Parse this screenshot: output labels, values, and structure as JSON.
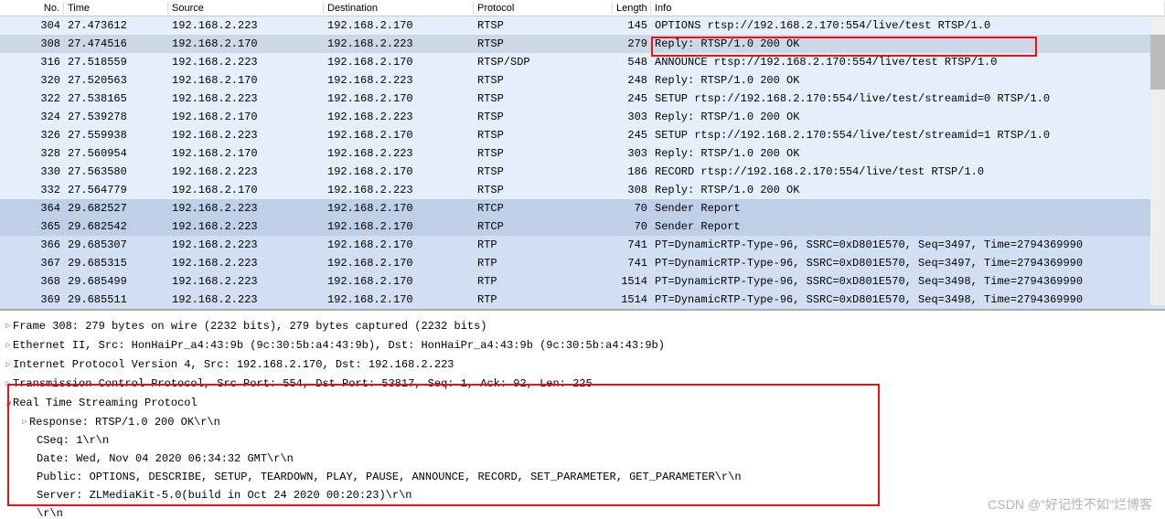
{
  "columns": {
    "no": "No.",
    "time": "Time",
    "src": "Source",
    "dst": "Destination",
    "proto": "Protocol",
    "len": "Length",
    "info": "Info"
  },
  "packets": [
    {
      "no": "304",
      "time": "27.473612",
      "src": "192.168.2.223",
      "dst": "192.168.2.170",
      "proto": "RTSP",
      "len": "145",
      "info": "OPTIONS rtsp://192.168.2.170:554/live/test RTSP/1.0",
      "cls": "alt0"
    },
    {
      "no": "308",
      "time": "27.474516",
      "src": "192.168.2.170",
      "dst": "192.168.2.223",
      "proto": "RTSP",
      "len": "279",
      "info": "Reply: RTSP/1.0 200 OK",
      "cls": "selected"
    },
    {
      "no": "316",
      "time": "27.518559",
      "src": "192.168.2.223",
      "dst": "192.168.2.170",
      "proto": "RTSP/SDP",
      "len": "548",
      "info": "ANNOUNCE rtsp://192.168.2.170:554/live/test RTSP/1.0",
      "cls": "alt0"
    },
    {
      "no": "320",
      "time": "27.520563",
      "src": "192.168.2.170",
      "dst": "192.168.2.223",
      "proto": "RTSP",
      "len": "248",
      "info": "Reply: RTSP/1.0 200 OK",
      "cls": "alt1"
    },
    {
      "no": "322",
      "time": "27.538165",
      "src": "192.168.2.223",
      "dst": "192.168.2.170",
      "proto": "RTSP",
      "len": "245",
      "info": "SETUP rtsp://192.168.2.170:554/live/test/streamid=0 RTSP/1.0",
      "cls": "alt0"
    },
    {
      "no": "324",
      "time": "27.539278",
      "src": "192.168.2.170",
      "dst": "192.168.2.223",
      "proto": "RTSP",
      "len": "303",
      "info": "Reply: RTSP/1.0 200 OK",
      "cls": "alt1"
    },
    {
      "no": "326",
      "time": "27.559938",
      "src": "192.168.2.223",
      "dst": "192.168.2.170",
      "proto": "RTSP",
      "len": "245",
      "info": "SETUP rtsp://192.168.2.170:554/live/test/streamid=1 RTSP/1.0",
      "cls": "alt0"
    },
    {
      "no": "328",
      "time": "27.560954",
      "src": "192.168.2.170",
      "dst": "192.168.2.223",
      "proto": "RTSP",
      "len": "303",
      "info": "Reply: RTSP/1.0 200 OK",
      "cls": "alt1"
    },
    {
      "no": "330",
      "time": "27.563580",
      "src": "192.168.2.223",
      "dst": "192.168.2.170",
      "proto": "RTSP",
      "len": "186",
      "info": "RECORD rtsp://192.168.2.170:554/live/test RTSP/1.0",
      "cls": "alt0"
    },
    {
      "no": "332",
      "time": "27.564779",
      "src": "192.168.2.170",
      "dst": "192.168.2.223",
      "proto": "RTSP",
      "len": "308",
      "info": "Reply: RTSP/1.0 200 OK",
      "cls": "alt1"
    },
    {
      "no": "364",
      "time": "29.682527",
      "src": "192.168.2.223",
      "dst": "192.168.2.170",
      "proto": "RTCP",
      "len": "70",
      "info": "Sender Report",
      "cls": "rtcp"
    },
    {
      "no": "365",
      "time": "29.682542",
      "src": "192.168.2.223",
      "dst": "192.168.2.170",
      "proto": "RTCP",
      "len": "70",
      "info": "Sender Report",
      "cls": "rtcp"
    },
    {
      "no": "366",
      "time": "29.685307",
      "src": "192.168.2.223",
      "dst": "192.168.2.170",
      "proto": "RTP",
      "len": "741",
      "info": "PT=DynamicRTP-Type-96, SSRC=0xD801E570, Seq=3497, Time=2794369990",
      "cls": "rtp"
    },
    {
      "no": "367",
      "time": "29.685315",
      "src": "192.168.2.223",
      "dst": "192.168.2.170",
      "proto": "RTP",
      "len": "741",
      "info": "PT=DynamicRTP-Type-96, SSRC=0xD801E570, Seq=3497, Time=2794369990",
      "cls": "rtp"
    },
    {
      "no": "368",
      "time": "29.685499",
      "src": "192.168.2.223",
      "dst": "192.168.2.170",
      "proto": "RTP",
      "len": "1514",
      "info": "PT=DynamicRTP-Type-96, SSRC=0xD801E570, Seq=3498, Time=2794369990",
      "cls": "rtp"
    },
    {
      "no": "369",
      "time": "29.685511",
      "src": "192.168.2.223",
      "dst": "192.168.2.170",
      "proto": "RTP",
      "len": "1514",
      "info": "PT=DynamicRTP-Type-96, SSRC=0xD801E570, Seq=3498, Time=2794369990",
      "cls": "rtp"
    }
  ],
  "details": {
    "frame": "Frame 308: 279 bytes on wire (2232 bits), 279 bytes captured (2232 bits)",
    "eth": "Ethernet II, Src: HonHaiPr_a4:43:9b (9c:30:5b:a4:43:9b), Dst: HonHaiPr_a4:43:9b (9c:30:5b:a4:43:9b)",
    "ip": "Internet Protocol Version 4, Src: 192.168.2.170, Dst: 192.168.2.223",
    "tcp": "Transmission Control Protocol, Src Port: 554, Dst Port: 53817, Seq: 1, Ack: 92, Len: 225",
    "rtsp": "Real Time Streaming Protocol",
    "response": "Response: RTSP/1.0 200 OK\\r\\n",
    "cseq": "CSeq: 1\\r\\n",
    "date": "Date: Wed, Nov 04 2020 06:34:32 GMT\\r\\n",
    "public": "Public: OPTIONS, DESCRIBE, SETUP, TEARDOWN, PLAY, PAUSE, ANNOUNCE, RECORD, SET_PARAMETER, GET_PARAMETER\\r\\n",
    "server": "Server: ZLMediaKit-5.0(build in Oct 24 2020 00:20:23)\\r\\n",
    "crlf": "\\r\\n"
  },
  "watermark": "CSDN @\"好记性不如\"烂博客"
}
